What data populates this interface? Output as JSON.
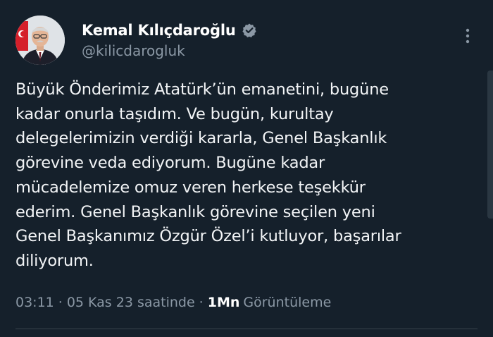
{
  "author": {
    "display_name": "Kemal Kılıçdaroğlu",
    "handle": "@kilicdarogluk",
    "verified_badge_color": "#8b98a5"
  },
  "tweet": {
    "lines": [
      "Büyük Önderimiz Atatürk’ün emanetini, bugüne",
      "kadar onurla taşıdım. Ve bugün, kurultay",
      "delegelerimizin verdiği kararla, Genel Başkanlık",
      "görevine veda ediyorum. Bugüne kadar",
      "mücadelemize omuz veren herkese teşekkür",
      "ederim. Genel Başkanlık görevine seçilen yeni",
      "Genel Başkanımız Özgür Özel’i kutluyor, başarılar",
      "diliyorum."
    ]
  },
  "meta": {
    "time": "03:11",
    "separator": "·",
    "date": "05 Kas 23 saatinde",
    "views_count": "1Mn",
    "views_label": "Görüntüleme"
  },
  "icons": {
    "more": "more-vertical-icon",
    "verified": "verified-badge-icon"
  },
  "colors": {
    "background": "#15202b",
    "text_primary": "#f2f4f6",
    "text_secondary": "#8b98a5",
    "divider": "#38444d"
  }
}
